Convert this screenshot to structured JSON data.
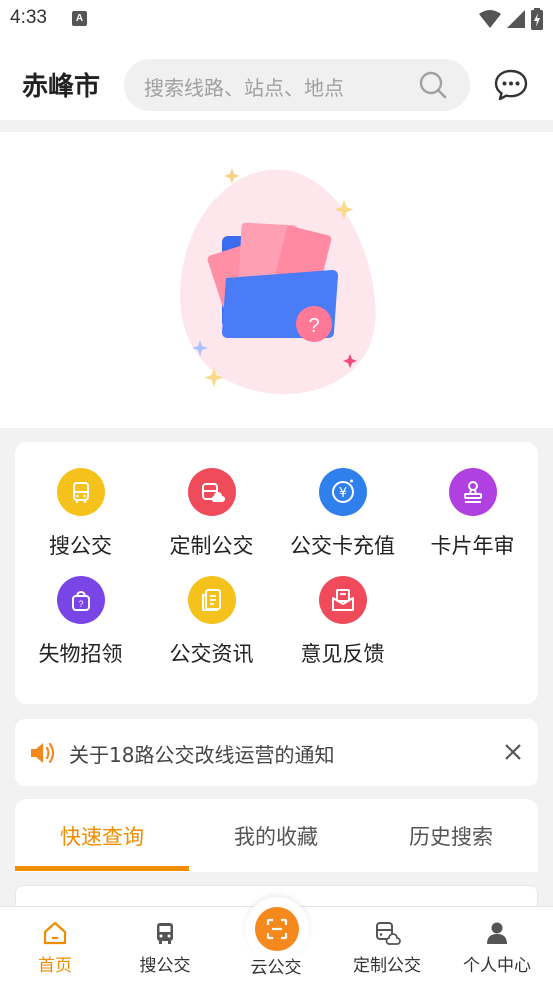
{
  "status_bar": {
    "time": "4:33",
    "notification_badge": "A"
  },
  "header": {
    "city": "赤峰市",
    "search_placeholder": "搜索线路、站点、地点"
  },
  "quick_menu": {
    "items": [
      {
        "label": "搜公交",
        "icon": "bus-search-icon",
        "color": "#f5c21b"
      },
      {
        "label": "定制公交",
        "icon": "custom-bus-icon",
        "color": "#ef4b5a"
      },
      {
        "label": "公交卡充值",
        "icon": "card-recharge-icon",
        "color": "#2f80ed"
      },
      {
        "label": "卡片年审",
        "icon": "stamp-icon",
        "color": "#b040e0"
      },
      {
        "label": "失物招领",
        "icon": "lost-found-bag-icon",
        "color": "#7a45e6"
      },
      {
        "label": "公交资讯",
        "icon": "news-icon",
        "color": "#f5c21b"
      },
      {
        "label": "意见反馈",
        "icon": "feedback-mail-icon",
        "color": "#ef4b5a"
      }
    ]
  },
  "notice": {
    "text": "关于18路公交改线运营的通知"
  },
  "tabs": [
    {
      "label": "快速查询",
      "active": true
    },
    {
      "label": "我的收藏",
      "active": false
    },
    {
      "label": "历史搜索",
      "active": false
    }
  ],
  "bottom_nav": [
    {
      "label": "首页",
      "icon": "home-icon",
      "active": true
    },
    {
      "label": "搜公交",
      "icon": "bus-icon",
      "active": false
    },
    {
      "label": "云公交",
      "icon": "scan-icon",
      "active": false
    },
    {
      "label": "定制公交",
      "icon": "custom-bus-icon",
      "active": false
    },
    {
      "label": "个人中心",
      "icon": "person-icon",
      "active": false
    }
  ],
  "colors": {
    "accent": "#f08c00",
    "background": "#f2f2f2"
  }
}
